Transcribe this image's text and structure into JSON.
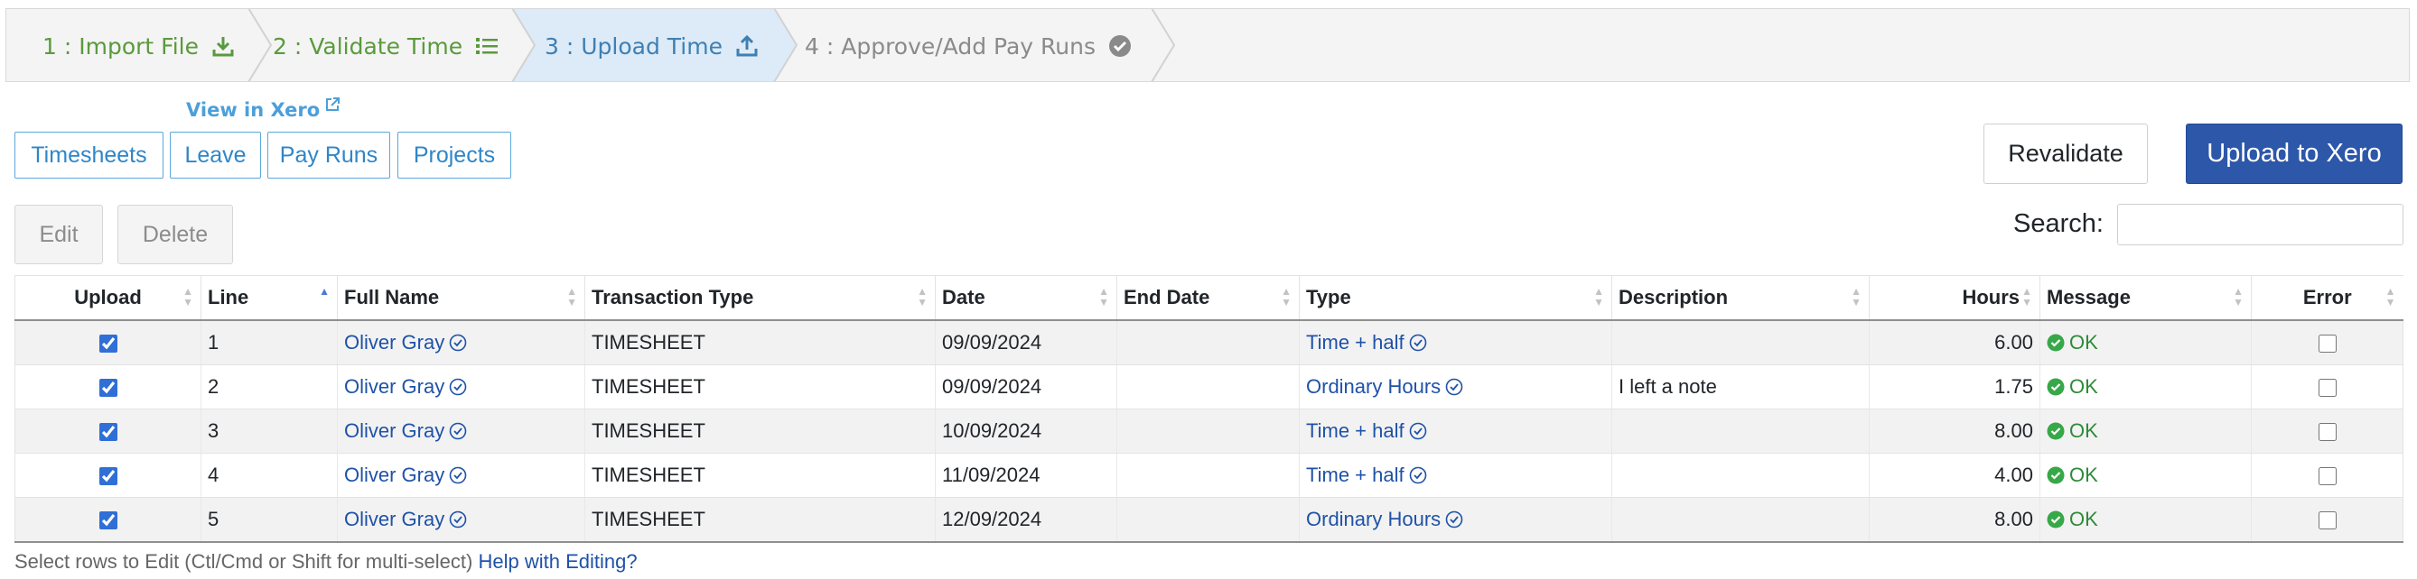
{
  "wizard": {
    "steps": [
      {
        "label": "1 : Import File",
        "state": "done",
        "icon": "download-icon"
      },
      {
        "label": "2 : Validate Time",
        "state": "done",
        "icon": "list-icon"
      },
      {
        "label": "3 : Upload Time",
        "state": "active",
        "icon": "upload-icon"
      },
      {
        "label": "4 : Approve/Add Pay Runs",
        "state": "todo",
        "icon": "check-circle-icon"
      }
    ]
  },
  "xero": {
    "view_label": "View in Xero",
    "links": [
      "Timesheets",
      "Leave",
      "Pay Runs",
      "Projects"
    ]
  },
  "actions": {
    "revalidate": "Revalidate",
    "upload": "Upload to Xero",
    "edit": "Edit",
    "delete": "Delete"
  },
  "search": {
    "label": "Search:",
    "value": ""
  },
  "table": {
    "columns": [
      "Upload",
      "Line",
      "Full Name",
      "Transaction Type",
      "Date",
      "End Date",
      "Type",
      "Description",
      "Hours",
      "Message",
      "Error"
    ],
    "rows": [
      {
        "upload": true,
        "line": "1",
        "name": "Oliver Gray",
        "tx": "TIMESHEET",
        "date": "09/09/2024",
        "end": "",
        "type": "Time + half",
        "desc": "",
        "hours": "6.00",
        "msg": "OK",
        "error": false
      },
      {
        "upload": true,
        "line": "2",
        "name": "Oliver Gray",
        "tx": "TIMESHEET",
        "date": "09/09/2024",
        "end": "",
        "type": "Ordinary Hours",
        "desc": "I left a note",
        "hours": "1.75",
        "msg": "OK",
        "error": false
      },
      {
        "upload": true,
        "line": "3",
        "name": "Oliver Gray",
        "tx": "TIMESHEET",
        "date": "10/09/2024",
        "end": "",
        "type": "Time + half",
        "desc": "",
        "hours": "8.00",
        "msg": "OK",
        "error": false
      },
      {
        "upload": true,
        "line": "4",
        "name": "Oliver Gray",
        "tx": "TIMESHEET",
        "date": "11/09/2024",
        "end": "",
        "type": "Time + half",
        "desc": "",
        "hours": "4.00",
        "msg": "OK",
        "error": false
      },
      {
        "upload": true,
        "line": "5",
        "name": "Oliver Gray",
        "tx": "TIMESHEET",
        "date": "12/09/2024",
        "end": "",
        "type": "Ordinary Hours",
        "desc": "",
        "hours": "8.00",
        "msg": "OK",
        "error": false
      }
    ]
  },
  "footer": {
    "hint": "Select rows to Edit (Ctl/Cmd or Shift for multi-select)",
    "help_link": "Help with Editing?"
  },
  "colors": {
    "done": "#5a9a3c",
    "active": "#3f7fb3",
    "active_bg": "#dcebf7",
    "todo": "#8a8a8a",
    "primary": "#2d57a9",
    "link": "#1f52a8",
    "ok": "#2e8b3a"
  }
}
